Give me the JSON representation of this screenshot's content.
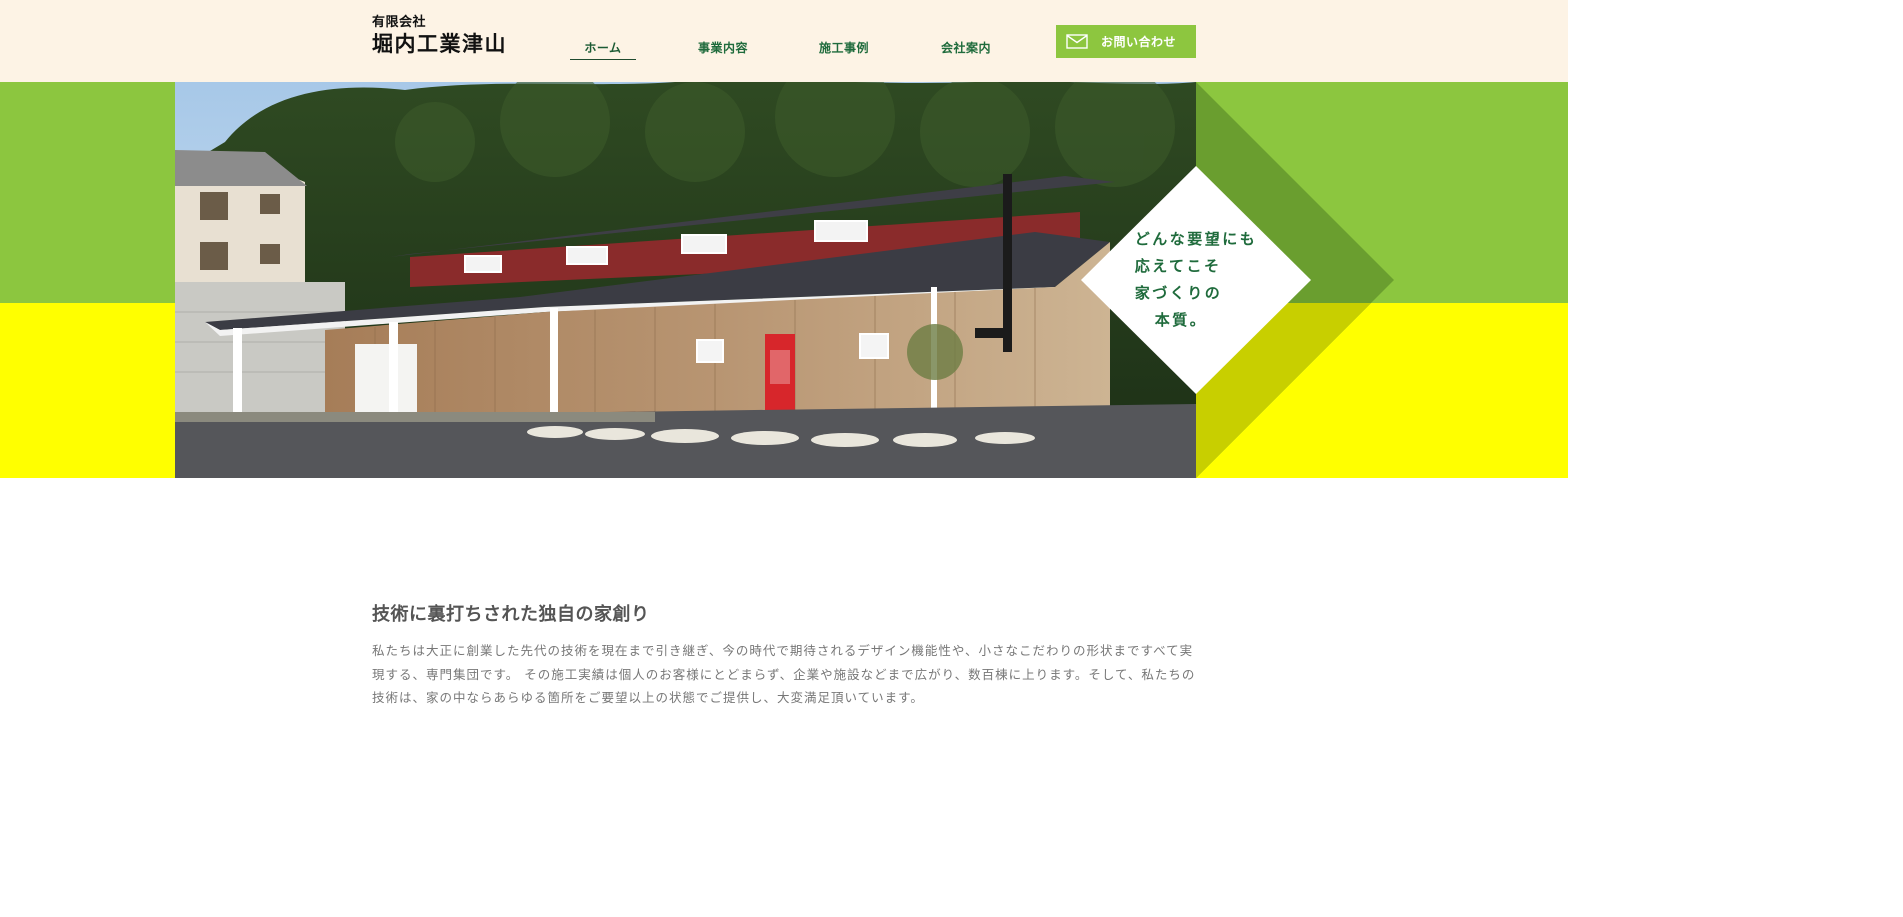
{
  "header": {
    "logo_small": "有限会社",
    "logo_main": "堀内工業津山"
  },
  "nav": {
    "items": [
      {
        "label": "ホーム",
        "active": true
      },
      {
        "label": "事業内容"
      },
      {
        "label": "施工事例"
      },
      {
        "label": "会社案内"
      }
    ],
    "contact_label": "お問い合わせ"
  },
  "hero": {
    "tagline_lines": [
      "どんな要望にも",
      "応えてこそ",
      "家づくりの",
      "本質。"
    ]
  },
  "intro": {
    "heading": "技術に裏打ちされた独自の家創り",
    "body": "私たちは大正に創業した先代の技術を現在まで引き継ぎ、今の時代で期待されるデザイン機能性や、小さなこだわりの形状まですべて実現する、専門集団です。 その施工実績は個人のお客様にとどまらず、企業や施設などまで広がり、数百棟に上ります。そして、私たちの技術は、家の中ならあらゆる箇所をご要望以上の状態でご提供し、大変満足頂いています。"
  },
  "colors": {
    "header_bg": "#fdf3e5",
    "green": "#8cc63f",
    "yellow": "#ffff00",
    "text_green": "#1f6b3c",
    "contact_bg": "#8dc63f"
  }
}
